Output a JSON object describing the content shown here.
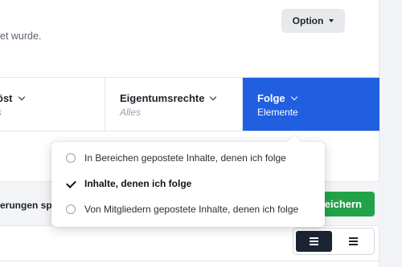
{
  "intro": {
    "text": "et wurde."
  },
  "option_button": {
    "label": "Option",
    "icon": "caret-down-icon"
  },
  "filters": [
    {
      "title": "öst",
      "subtitle": "s",
      "icon": "chevron-down-icon"
    },
    {
      "title": "Eigentumsrechte",
      "subtitle": "Alles",
      "icon": "chevron-down-icon"
    },
    {
      "title": "Folge",
      "subtitle": "Elemente",
      "icon": "chevron-down-icon",
      "active": true
    }
  ],
  "dropdown": {
    "items": [
      {
        "label": "In Bereichen gepostete Inhalte, denen ich folge",
        "state": "radio-unselected"
      },
      {
        "label": "Inhalte, denen ich folge",
        "state": "checked"
      },
      {
        "label": "Von Mitgliedern gepostete Inhalte, denen ich folge",
        "state": "radio-unselected"
      }
    ]
  },
  "settings": {
    "label": "erungen sp",
    "save_label": "eichern"
  },
  "view_toggle": {
    "options": [
      {
        "icon": "list-view-icon",
        "selected": true
      },
      {
        "icon": "compact-list-icon",
        "selected": false
      }
    ]
  },
  "colors": {
    "accent": "#1f5fe0",
    "save": "#22a34a",
    "toggle_selected": "#1c2333"
  }
}
